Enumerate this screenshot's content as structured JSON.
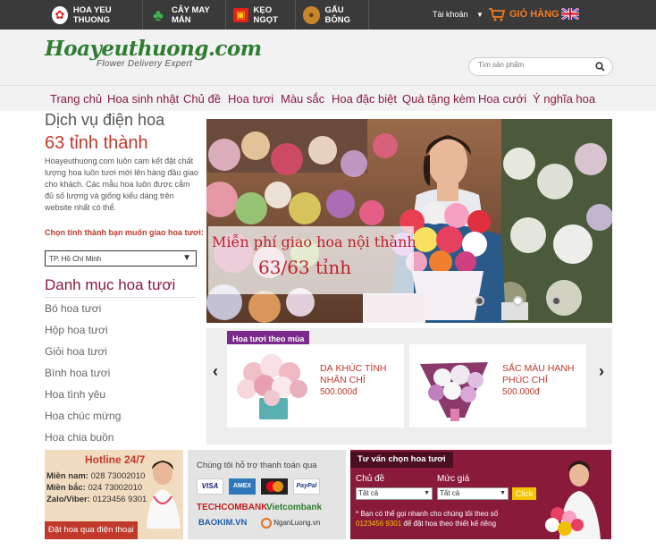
{
  "topbar": {
    "items": [
      {
        "label": "HOA YEU THUONG",
        "icon": "flower-icon",
        "color": "#e2231a"
      },
      {
        "label": "CÂY MAY MẮN",
        "icon": "clover-icon",
        "color": "#3bb54a"
      },
      {
        "label": "KẸO NGỌT",
        "icon": "gift-icon",
        "color": "#e2231a"
      },
      {
        "label": "GẤU BÔNG",
        "icon": "bear-icon",
        "color": "#c8862b"
      }
    ],
    "account": "Tài khoản",
    "account_arrow": "▼",
    "cart_label": "GIỎ HÀNG",
    "accent": "#f47b20"
  },
  "header": {
    "logo_main": "Hoayeuthuong.com",
    "logo_sub": "Flower Delivery Expert",
    "search_placeholder": "Tìm sản phẩm"
  },
  "nav": {
    "items": [
      "Trang chủ",
      "Hoa sinh nhật",
      "Chủ đề",
      "Hoa tươi",
      "Màu sắc",
      "Hoa đặc biệt",
      "Quà tặng kèm",
      "Hoa cưới",
      "Ý nghĩa hoa"
    ]
  },
  "left": {
    "service_title": "Dịch vụ điện hoa",
    "service_count": "63 tỉnh thành",
    "description": "Hoayeuthuong.com luôn cam kết đặt chất lượng hoa luôn tươi mới lên hàng đầu giao cho khách. Các mẫu hoa luôn được cắm đủ số lượng và giống kiểu dáng trên website nhất có thể.",
    "choose_city_label": "Chọn tỉnh thành bạn muốn giao hoa tươi:",
    "city_selected": "TP. Hồ Chí Minh",
    "category_title": "Danh mục hoa tươi",
    "categories": [
      "Bó hoa tươi",
      "Hộp hoa tươi",
      "Giỏi hoa tươi",
      "Bình hoa tươi",
      "Hoa tình yêu",
      "Hoa chúc mừng",
      "Hoa chia buồn"
    ]
  },
  "banner": {
    "line1": "Miễn phí giao hoa nội thành",
    "line2": "63/63 tỉnh"
  },
  "season": {
    "tab": "Hoa tươi theo mùa",
    "products": [
      {
        "name": "DẠ KHÚC TÌNH NHÂN CHỈ",
        "price": "500.000đ"
      },
      {
        "name": "SẮC MÀU HẠNH PHÚC CHỈ",
        "price": "500.000đ"
      }
    ],
    "prev": "‹",
    "next": "›"
  },
  "hotline": {
    "title": "Hotline 24/7",
    "rows": [
      {
        "label": "Miền nam:",
        "value": "028 73002010"
      },
      {
        "label": "Miền bắc:",
        "value": "024 73002010"
      },
      {
        "label": "Zalo/Viber:",
        "value": "0123456 9301"
      }
    ],
    "cta": "Đặt hoa qua điện thoại"
  },
  "payment": {
    "title": "Chúng tôi hỗ trợ thanh toán qua",
    "cards": [
      "VISA",
      "AMEX",
      "MC",
      "PayPal"
    ],
    "banks": [
      "TECHCOMBANK",
      "Vietcombank"
    ],
    "wallets": [
      "BAOKIM.VN",
      "NganLuong.vn"
    ]
  },
  "advice": {
    "title": "Tư vấn chọn hoa tươi",
    "topic_label": "Chủ đề",
    "price_label": "Mức giá",
    "topic_value": "Tất cả",
    "price_value": "Tất cả",
    "button": "Click",
    "note_prefix": "* Bạn có thể gọi nhanh cho chúng tôi theo số ",
    "note_phone": "0123456 9301",
    "note_suffix": " để đặt hoa theo thiết kế riêng"
  }
}
